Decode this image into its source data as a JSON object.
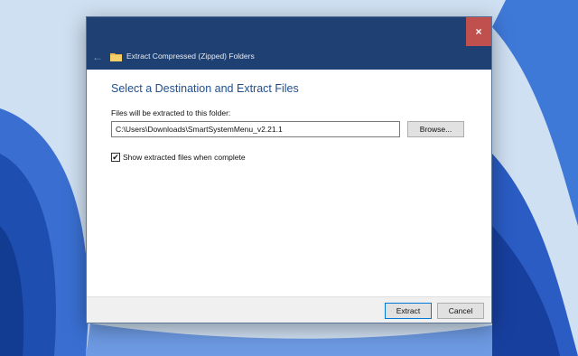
{
  "dialog": {
    "title": "Extract Compressed (Zipped) Folders",
    "close_label": "×",
    "back_label": "←",
    "heading": "Select a Destination and Extract Files",
    "path_label": "Files will be extracted to this folder:",
    "path_value": "C:\\Users\\Downloads\\SmartSystemMenu_v2.21.1",
    "browse_label": "Browse...",
    "show_files": {
      "label": "Show extracted files when complete",
      "checked": true,
      "mark": "✔"
    },
    "extract_label": "Extract",
    "cancel_label": "Cancel"
  },
  "colors": {
    "titlebar": "#1f4072",
    "close_button": "#c0504d",
    "heading": "#1f4f8f",
    "wallpaper_light": "#cfe0f2",
    "wallpaper_blue": "#2f62c8"
  },
  "icons": {
    "folder": "folder-icon",
    "back": "back-arrow-icon",
    "close": "close-icon",
    "check": "checkmark-icon"
  }
}
